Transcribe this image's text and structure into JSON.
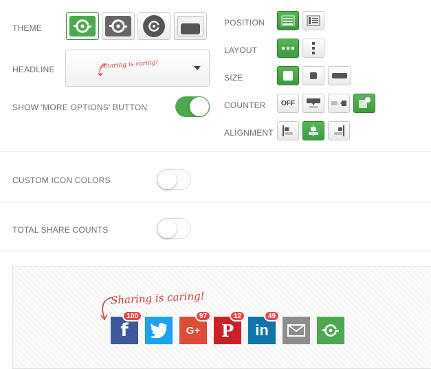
{
  "left_labels": {
    "theme": "THEME",
    "headline": "HEADLINE",
    "more_options": "SHOW 'MORE OPTIONS' BUTTON"
  },
  "right_labels": {
    "position": "POSITION",
    "layout": "LAYOUT",
    "size": "SIZE",
    "counter": "COUNTER",
    "alignment": "ALIGNMENT"
  },
  "headline_value": "Sharing is caring!",
  "counter_off_label": "OFF",
  "toggles": {
    "more_options": true,
    "custom_icon_colors": false,
    "total_share_counts": false
  },
  "sections": {
    "custom_icon_colors": "CUSTOM ICON COLORS",
    "total_share_counts": "TOTAL SHARE COUNTS"
  },
  "preview": {
    "headline": "Sharing is caring!",
    "buttons": [
      {
        "network": "facebook",
        "glyph": "f",
        "count": "100",
        "color": "#3b5998"
      },
      {
        "network": "twitter",
        "glyph": "t",
        "count": null,
        "color": "#1da1f2"
      },
      {
        "network": "google-plus",
        "glyph": "G+",
        "count": "97",
        "color": "#dd4b39"
      },
      {
        "network": "pinterest",
        "glyph": "P",
        "count": "12",
        "color": "#cb2027"
      },
      {
        "network": "linkedin",
        "glyph": "in",
        "count": "49",
        "color": "#0e76a8"
      },
      {
        "network": "email",
        "glyph": "",
        "count": null,
        "color": "#8d8d8d"
      },
      {
        "network": "more",
        "glyph": "",
        "count": null,
        "color": "#4fa84f"
      }
    ]
  },
  "colors": {
    "accent_green": "#4fa84f",
    "label_gray": "#6f6f6f",
    "badge_red": "#e24b4b",
    "headline_red": "#d33a3a"
  }
}
